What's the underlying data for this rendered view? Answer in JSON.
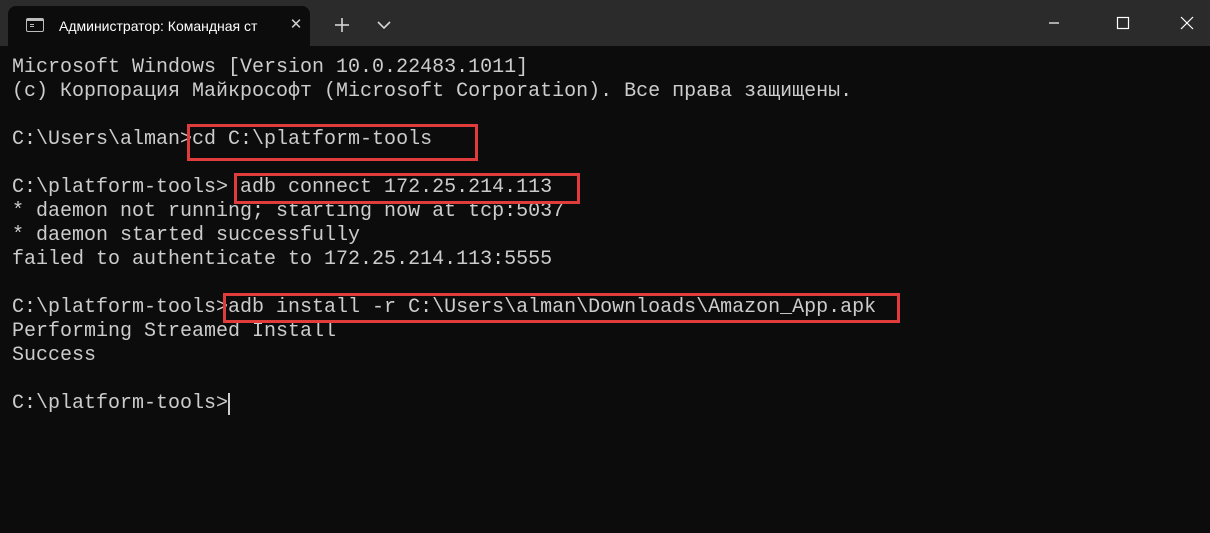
{
  "tab": {
    "title": "Администратор: Командная ст",
    "icon": "terminal-icon"
  },
  "titlebar_icons": {
    "new_tab": "plus-icon",
    "dropdown": "chevron-down-icon",
    "minimize": "minimize-icon",
    "maximize": "maximize-icon",
    "close": "close-icon"
  },
  "console": {
    "lines": [
      "Microsoft Windows [Version 10.0.22483.1011]",
      "(c) Корпорация Майкрософт (Microsoft Corporation). Все права защищены.",
      "C:\\Users\\alman>cd C:\\platform-tools",
      "C:\\platform-tools> adb connect 172.25.214.113",
      "* daemon not running; starting now at tcp:5037",
      "* daemon started successfully",
      "failed to authenticate to 172.25.214.113:5555",
      "C:\\platform-tools>adb install -r C:\\Users\\alman\\Downloads\\Amazon_App.apk",
      "Performing Streamed Install",
      "Success",
      "C:\\platform-tools>"
    ]
  },
  "colors": {
    "background": "#0c0c0c",
    "titlebar": "#2b2b2b",
    "text": "#cccccc",
    "highlight": "#e03c3c"
  }
}
